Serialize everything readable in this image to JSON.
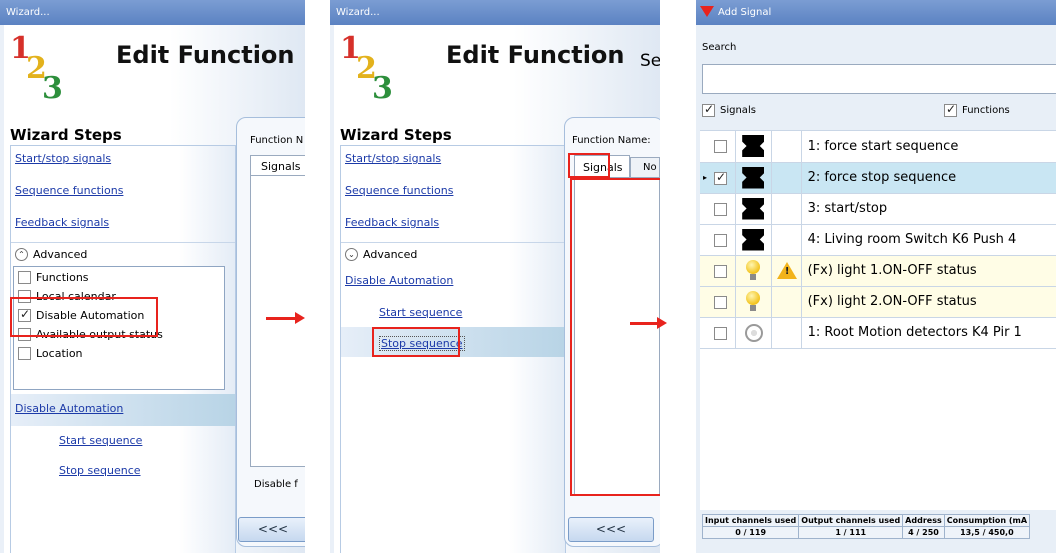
{
  "panel1": {
    "title": "Wizard...",
    "logo": [
      "1",
      "2",
      "3"
    ],
    "heading": "Edit Function",
    "steps_title": "Wizard Steps",
    "links": [
      "Start/stop signals",
      "Sequence functions",
      "Feedback signals"
    ],
    "advanced": "Advanced",
    "options": [
      {
        "label": "Functions",
        "checked": false
      },
      {
        "label": "Local calendar",
        "checked": false
      },
      {
        "label": "Disable Automation",
        "checked": true
      },
      {
        "label": "Available output status",
        "checked": false
      },
      {
        "label": "Location",
        "checked": false
      }
    ],
    "section": "Disable Automation",
    "sub_links": [
      "Start sequence",
      "Stop sequence"
    ],
    "function_name": "Function N",
    "tab": "Signals",
    "disable_label": "Disable f",
    "back": "<<<"
  },
  "panel2": {
    "title": "Wizard...",
    "logo": [
      "1",
      "2",
      "3"
    ],
    "heading": "Edit Function",
    "heading_tail": "Se",
    "steps_title": "Wizard Steps",
    "links": [
      "Start/stop signals",
      "Sequence functions",
      "Feedback signals"
    ],
    "advanced": "Advanced",
    "section": "Disable Automation",
    "sub_links": [
      "Start sequence",
      "Stop sequence"
    ],
    "function_name": "Function Name:",
    "tabs": [
      "Signals",
      "No"
    ],
    "back": "<<<"
  },
  "panel3": {
    "title": "Add Signal",
    "search_label": "Search",
    "search_value": "",
    "filter_signals": "Signals",
    "filter_functions": "Functions",
    "rows": [
      {
        "label": "1: force start sequence",
        "checked": false,
        "icon": "switch-icon"
      },
      {
        "label": "2: force stop sequence",
        "checked": true,
        "icon": "switch-icon"
      },
      {
        "label": "3: start/stop",
        "checked": false,
        "icon": "switch-icon"
      },
      {
        "label": "4: Living room Switch K6 Push 4",
        "checked": false,
        "icon": "switch-icon"
      },
      {
        "label": "(Fx) light 1.ON-OFF status",
        "checked": false,
        "icon": "bulb-icon"
      },
      {
        "label": "(Fx) light 2.ON-OFF status",
        "checked": false,
        "icon": "bulb-icon"
      },
      {
        "label": "1: Root Motion detectors K4 Pir 1",
        "checked": false,
        "icon": "motion-sensor-icon"
      }
    ],
    "footer_headers": [
      "Input channels used",
      "Output channels used",
      "Address",
      "Consumption (mA"
    ],
    "footer_values": [
      "0 / 119",
      "1 / 111",
      "4 / 250",
      "13,5 / 450,0"
    ]
  },
  "colors": {
    "highlight": "#e8231d",
    "titlebar": "#6b90cb",
    "selected_row": "#c9e6f3",
    "fx_row": "#fffde6"
  }
}
